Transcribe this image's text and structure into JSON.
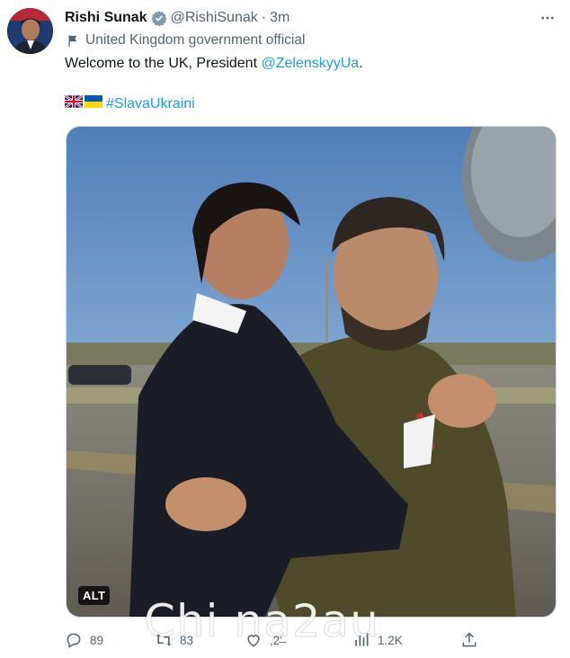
{
  "author": {
    "name": "Rishi Sunak",
    "handle": "@RishiSunak",
    "separator": "·",
    "time": "3m",
    "label": "United Kingdom government official"
  },
  "tweet": {
    "text_prefix": "Welcome to the UK, President ",
    "mention": "@ZelenskyyUa",
    "text_suffix": ".",
    "hashtag": "#SlavaUkraini"
  },
  "media": {
    "alt_badge": "ALT"
  },
  "actions": {
    "replies": "89",
    "retweets": "83",
    "likes": ",2‘̶",
    "views": "1.2K"
  },
  "watermark": "Chi na2au",
  "colors": {
    "accent": "#1d9bf0",
    "secondary": "#536471",
    "text": "#0f1419"
  },
  "icons": [
    "verified-badge-icon",
    "more-options-icon",
    "government-flag-icon",
    "uk-flag-icon",
    "ukraine-flag-icon",
    "reply-icon",
    "retweet-icon",
    "like-icon",
    "views-icon",
    "share-icon"
  ]
}
